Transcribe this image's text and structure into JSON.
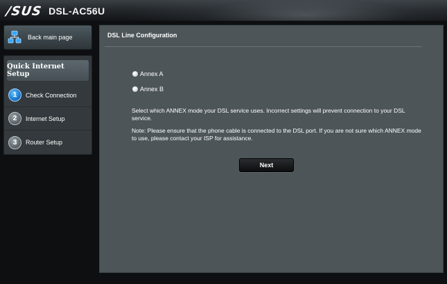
{
  "header": {
    "logo": "/SUS",
    "model": "DSL-AC56U"
  },
  "sidebar": {
    "back_label": "Back main page",
    "qis_title": "Quick Internet Setup",
    "steps": [
      {
        "num": "1",
        "label": "Check Connection"
      },
      {
        "num": "2",
        "label": "Internet Setup"
      },
      {
        "num": "3",
        "label": "Router Setup"
      }
    ]
  },
  "main": {
    "title": "DSL Line Configuration",
    "options": [
      {
        "label": "Annex A"
      },
      {
        "label": "Annex B"
      }
    ],
    "description": "Select which ANNEX mode your DSL service uses. Incorrect settings will prevent connection to your DSL service.",
    "note": "Note: Please ensure that the phone cable is connected to the DSL port. If you are not sure which ANNEX mode to use, please contact your ISP for assistance.",
    "next_label": "Next"
  },
  "colors": {
    "accent_blue": "#1c7fd1",
    "panel_bg": "#4d5559",
    "page_bg": "#0d0f11"
  }
}
